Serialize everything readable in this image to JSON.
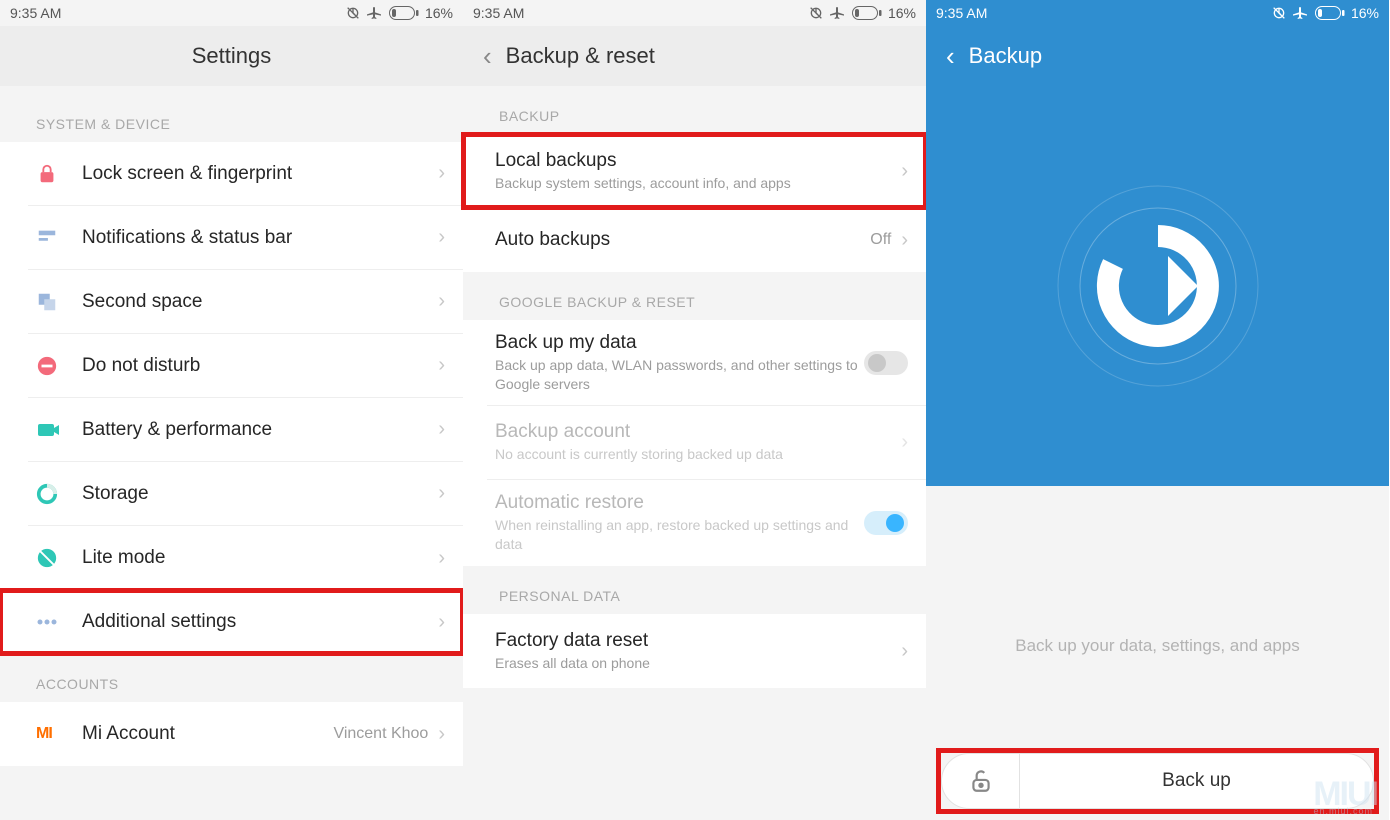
{
  "status": {
    "time": "9:35 AM",
    "battery_pct": "16%"
  },
  "panel1": {
    "title": "Settings",
    "section_system": "SYSTEM & DEVICE",
    "items": [
      {
        "label": "Lock screen & fingerprint"
      },
      {
        "label": "Notifications & status bar"
      },
      {
        "label": "Second space"
      },
      {
        "label": "Do not disturb"
      },
      {
        "label": "Battery & performance"
      },
      {
        "label": "Storage"
      },
      {
        "label": "Lite mode"
      },
      {
        "label": "Additional settings"
      }
    ],
    "section_accounts": "ACCOUNTS",
    "mi_account": {
      "label": "Mi Account",
      "value": "Vincent Khoo"
    }
  },
  "panel2": {
    "title": "Backup & reset",
    "section_backup": "BACKUP",
    "local": {
      "label": "Local backups",
      "sub": "Backup system settings, account info, and apps"
    },
    "auto": {
      "label": "Auto backups",
      "value": "Off"
    },
    "section_google": "GOOGLE BACKUP & RESET",
    "backup_data": {
      "label": "Back up my data",
      "sub": "Back up app data, WLAN passwords, and other settings to Google servers"
    },
    "backup_account": {
      "label": "Backup account",
      "sub": "No account is currently storing backed up data"
    },
    "auto_restore": {
      "label": "Automatic restore",
      "sub": "When reinstalling an app, restore backed up settings and data"
    },
    "section_personal": "PERSONAL DATA",
    "factory": {
      "label": "Factory data reset",
      "sub": "Erases all data on phone"
    }
  },
  "panel3": {
    "title": "Backup",
    "hint": "Back up your data, settings, and apps",
    "button": "Back up"
  },
  "watermark": "MIUI",
  "watermark_sub": "en.miui.com"
}
